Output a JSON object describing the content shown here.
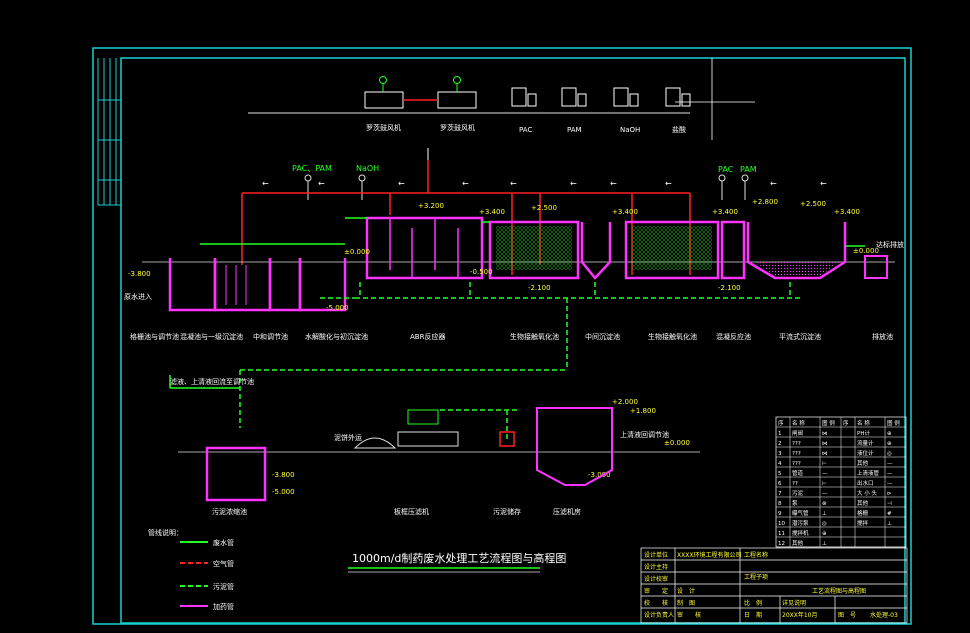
{
  "drawing": {
    "title_main": "1000m",
    "title_rest": "/d制药废水处理工艺流程图与高程图",
    "colors": {
      "background": "#000000",
      "frame": "#19d0d0",
      "water_line": "#22ff22",
      "air_line": "#ff2020",
      "sludge_line": "#22ff22",
      "dosing_line": "#ff33ff",
      "tank": "#ff33ff"
    }
  },
  "equipment": {
    "blower_1": "罗茨鼓风机",
    "blower_2": "罗茨鼓风机",
    "pac": "PAC",
    "pam": "PAM",
    "naoh": "NaOH",
    "acid": "盐酸"
  },
  "dosing_labels": {
    "left_pac_pam": "PAC、PAM",
    "left_naoh": "NaOH",
    "right_pac": "PAC",
    "right_pam": "PAM"
  },
  "elevations": {
    "e_3800_top": "-3.800",
    "e_0000_a": "±0.000",
    "e_5000_top": "-5.000",
    "e_3200": "+3.200",
    "e_3400_a": "+3.400",
    "e_2500": "+2.500",
    "e_3400_b": "+3.400",
    "e_3400_c": "+3.400",
    "e_2800": "+2.800",
    "e_2500_b": "+2.500",
    "e_3400_d": "+3.400",
    "e_0000_b": "±0.000",
    "e_2100_a": "-2.100",
    "e_2100_b": "-2.100",
    "e_0500": "-0.500",
    "e_2000_press": "+2.000",
    "e_1800": "+1.800",
    "e_0000_press": "±0.000",
    "e_3000": "-3.000",
    "e_3800_b": "-3.800",
    "e_5000_b": "-5.000"
  },
  "process_units": [
    "格栅池与调节池",
    "混凝池与一级沉淀池",
    "中和调节池",
    "水解酸化与初沉淀池",
    "ABR反应器",
    "生物接触氧化池",
    "中间沉淀池",
    "生物接触氧化池",
    "混凝反应池",
    "平流式沉淀池",
    "排放池"
  ],
  "bottom_units": [
    "污泥浓缩池",
    "板框压滤机",
    "污泥储存",
    "压滤机房"
  ],
  "side_labels": {
    "inlet": "原水进入",
    "outlet": "达标排放",
    "sludge_ext": "泥饼外运",
    "sludge_reflux": "滤液、上清液回流至调节池",
    "press_out": "上清液回调节池",
    "sludge_cake_text": "泥饼外运"
  },
  "legend": {
    "title": "管线说明：",
    "items": [
      {
        "label": "废水管",
        "color": "#22ff22",
        "style": "solid"
      },
      {
        "label": "空气管",
        "color": "#ff2020",
        "style": "dashed"
      },
      {
        "label": "污泥管",
        "color": "#22ff22",
        "style": "dashed"
      },
      {
        "label": "加药管",
        "color": "#ff33ff",
        "style": "solid"
      }
    ]
  },
  "equipment_table": {
    "header": [
      "序",
      "名 称",
      "图 例",
      "序",
      "名 称",
      "图 例"
    ],
    "rows": [
      [
        "1",
        "闸阀",
        "⋈",
        "",
        "PH计",
        "⊕"
      ],
      [
        "2",
        "???",
        "⋈",
        "",
        "流量计",
        "⊕"
      ],
      [
        "3",
        "???",
        "⋈",
        "",
        "液位计",
        "◎"
      ],
      [
        "4",
        "???",
        "⊢",
        "",
        "其他",
        "—"
      ],
      [
        "5",
        "管道",
        "—",
        "",
        "上清液管",
        "—"
      ],
      [
        "6",
        "??",
        "⊢",
        "",
        "出水口",
        "—"
      ],
      [
        "7",
        "污泥",
        "—",
        "",
        "大 小 头",
        "⊳"
      ],
      [
        "8",
        "泵",
        "⊗",
        "",
        "其他",
        "⊣"
      ],
      [
        "9",
        "曝气管",
        "⊥",
        "",
        "格栅",
        "#"
      ],
      [
        "10",
        "潜污泵",
        "◎",
        "",
        "搅拌",
        "⊥"
      ],
      [
        "11",
        "搅拌机",
        "⊕",
        "",
        "",
        ""
      ],
      [
        "12",
        "其他",
        "⊥",
        "",
        "",
        ""
      ]
    ]
  },
  "title_block": {
    "design_unit_label": "设计单位",
    "design_unit": "XXXX环境工程有限公司",
    "project_name_label": "工程名称",
    "project_sub_label": "工程子项",
    "rows_left": [
      "设计主持",
      "设计校审",
      "审　　定",
      "校　　核",
      "设计负责人",
      "审　　核"
    ],
    "drawing_name": "工艺流程图与高程图",
    "design_label": "设　计",
    "drawn_label": "制　图",
    "date_label": "日　期",
    "date": "20XX年10月",
    "drawing_no_label": "图　号",
    "drawing_no": "水处理-03",
    "scale_label": "比　例",
    "scale": "详见说明"
  }
}
